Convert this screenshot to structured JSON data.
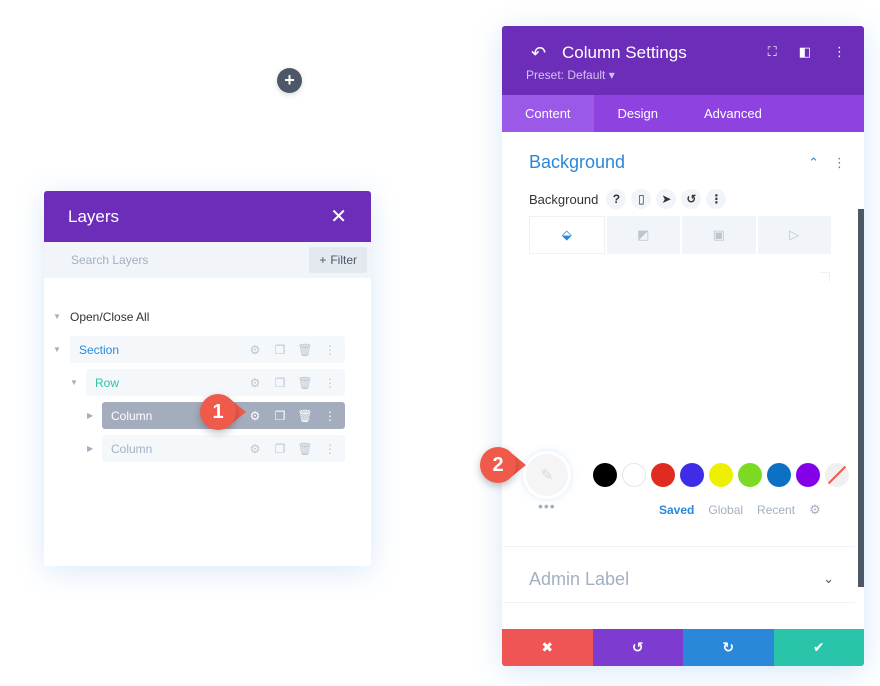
{
  "canvas": {
    "add_icon": "plus-icon",
    "add_glyph": "+"
  },
  "layers": {
    "title": "Layers",
    "close_glyph": "✕",
    "search_placeholder": "Search Layers",
    "filter_label": "Filter",
    "filter_glyph": "+",
    "open_close_all": "Open/Close All",
    "toggle_open": "▼",
    "toggle_closed": "▶",
    "nodes": [
      {
        "label": "Section",
        "type": "section",
        "level": 0,
        "expanded": true
      },
      {
        "label": "Row",
        "type": "row",
        "level": 1,
        "expanded": true
      },
      {
        "label": "Column",
        "type": "column",
        "level": 2,
        "expanded": false,
        "active": true
      },
      {
        "label": "Column",
        "type": "column",
        "level": 2,
        "expanded": false,
        "active": false
      }
    ],
    "action_glyphs": {
      "settings": "⚙",
      "duplicate": "❐",
      "delete": "🗑",
      "more": "⋮"
    }
  },
  "callouts": [
    {
      "number": "1",
      "target": "column-settings-gear"
    },
    {
      "number": "2",
      "target": "color-picker"
    }
  ],
  "settings": {
    "back_glyph": "↶",
    "title": "Column Settings",
    "preset": "Preset: Default ▾",
    "header_icons": {
      "fullscreen": "⛶",
      "sidebar": "◧",
      "more": "⋮"
    },
    "tabs": [
      {
        "label": "Content",
        "active": true
      },
      {
        "label": "Design",
        "active": false
      },
      {
        "label": "Advanced",
        "active": false
      }
    ],
    "section_title": "Background",
    "section_chevron": "⌃",
    "section_more": "⋮",
    "bg_label": "Background",
    "bg_icons": {
      "help": "?",
      "responsive": "▯",
      "hover": "➤",
      "reset": "↺",
      "more": "⋮"
    },
    "bg_tabs": [
      {
        "name": "color",
        "glyph": "⬙",
        "active": true
      },
      {
        "name": "gradient",
        "glyph": "◩",
        "active": false
      },
      {
        "name": "image",
        "glyph": "▣",
        "active": false
      },
      {
        "name": "video",
        "glyph": "▷",
        "active": false
      }
    ],
    "picker_glyph": "✎",
    "swatches": [
      "#000000",
      "#ffffff",
      "#e02b20",
      "#3e2ce6",
      "#edf000",
      "#7cda24",
      "#0c71c3",
      "#8300e9"
    ],
    "swatch_none": "no-color",
    "more_dots": "•••",
    "palette_tabs": [
      {
        "label": "Saved",
        "active": true
      },
      {
        "label": "Global",
        "active": false
      },
      {
        "label": "Recent",
        "active": false
      }
    ],
    "palette_gear": "⚙",
    "admin_label": "Admin Label",
    "admin_chevron": "⌄",
    "footer": [
      {
        "name": "discard",
        "glyph": "✖",
        "color": "#ef5555"
      },
      {
        "name": "undo",
        "glyph": "↺",
        "color": "#7e3bd0"
      },
      {
        "name": "redo",
        "glyph": "↻",
        "color": "#2b87da"
      },
      {
        "name": "save",
        "glyph": "✔",
        "color": "#29c4a9"
      }
    ]
  }
}
